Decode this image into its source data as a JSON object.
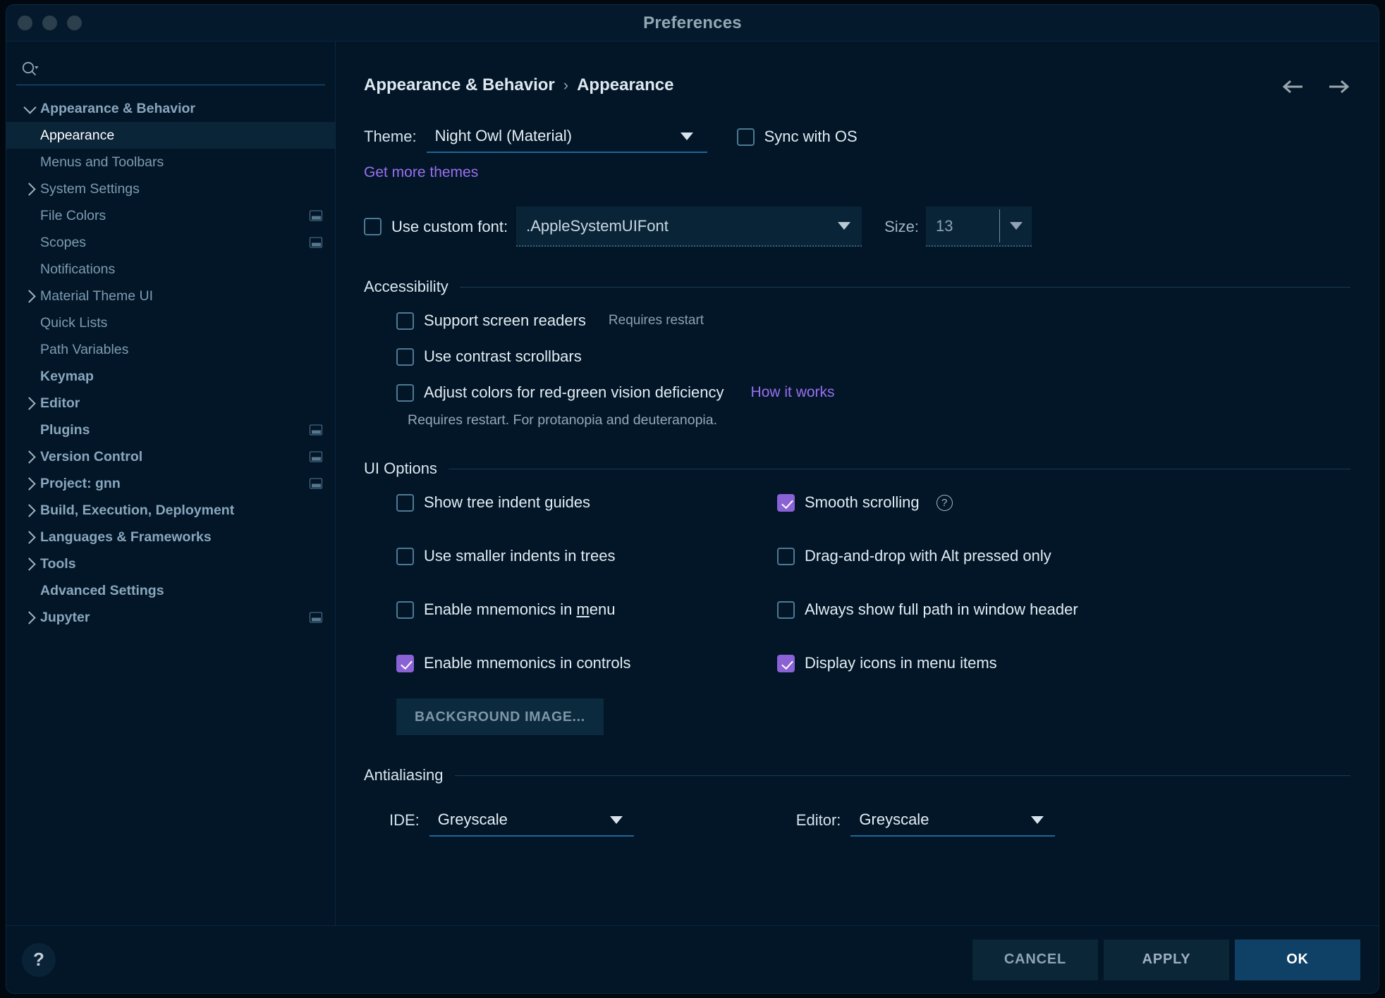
{
  "window": {
    "title": "Preferences"
  },
  "search": {
    "placeholder": "",
    "value": "",
    "icon": "search-icon"
  },
  "sidebar": {
    "items": [
      {
        "label": "Appearance & Behavior",
        "indent": 0,
        "arrow": "down",
        "bold": true,
        "selected": false,
        "badge": false
      },
      {
        "label": "Appearance",
        "indent": 1,
        "arrow": "none",
        "bold": false,
        "selected": true,
        "badge": false
      },
      {
        "label": "Menus and Toolbars",
        "indent": 1,
        "arrow": "none",
        "bold": false,
        "selected": false,
        "badge": false
      },
      {
        "label": "System Settings",
        "indent": 1,
        "arrow": "right",
        "bold": false,
        "selected": false,
        "badge": false
      },
      {
        "label": "File Colors",
        "indent": 1,
        "arrow": "none",
        "bold": false,
        "selected": false,
        "badge": true
      },
      {
        "label": "Scopes",
        "indent": 1,
        "arrow": "none",
        "bold": false,
        "selected": false,
        "badge": true
      },
      {
        "label": "Notifications",
        "indent": 1,
        "arrow": "none",
        "bold": false,
        "selected": false,
        "badge": false
      },
      {
        "label": "Material Theme UI",
        "indent": 1,
        "arrow": "right",
        "bold": false,
        "selected": false,
        "badge": false
      },
      {
        "label": "Quick Lists",
        "indent": 1,
        "arrow": "none",
        "bold": false,
        "selected": false,
        "badge": false
      },
      {
        "label": "Path Variables",
        "indent": 1,
        "arrow": "none",
        "bold": false,
        "selected": false,
        "badge": false
      },
      {
        "label": "Keymap",
        "indent": 0,
        "arrow": "none",
        "bold": true,
        "selected": false,
        "badge": false
      },
      {
        "label": "Editor",
        "indent": 0,
        "arrow": "right",
        "bold": true,
        "selected": false,
        "badge": false
      },
      {
        "label": "Plugins",
        "indent": 0,
        "arrow": "none",
        "bold": true,
        "selected": false,
        "badge": true
      },
      {
        "label": "Version Control",
        "indent": 0,
        "arrow": "right",
        "bold": true,
        "selected": false,
        "badge": true
      },
      {
        "label": "Project: gnn",
        "indent": 0,
        "arrow": "right",
        "bold": true,
        "selected": false,
        "badge": true
      },
      {
        "label": "Build, Execution, Deployment",
        "indent": 0,
        "arrow": "right",
        "bold": true,
        "selected": false,
        "badge": false
      },
      {
        "label": "Languages & Frameworks",
        "indent": 0,
        "arrow": "right",
        "bold": true,
        "selected": false,
        "badge": false
      },
      {
        "label": "Tools",
        "indent": 0,
        "arrow": "right",
        "bold": true,
        "selected": false,
        "badge": false
      },
      {
        "label": "Advanced Settings",
        "indent": 0,
        "arrow": "none",
        "bold": true,
        "selected": false,
        "badge": false
      },
      {
        "label": "Jupyter",
        "indent": 0,
        "arrow": "right",
        "bold": true,
        "selected": false,
        "badge": true
      }
    ]
  },
  "main": {
    "breadcrumb": {
      "parent": "Appearance & Behavior",
      "separator": "›",
      "current": "Appearance"
    },
    "nav": {
      "back_icon": "arrow-left-icon",
      "forward_icon": "arrow-right-icon"
    },
    "theme": {
      "label": "Theme:",
      "value": "Night Owl (Material)",
      "sync_label": "Sync with OS",
      "sync_checked": false,
      "get_more_themes": "Get more themes"
    },
    "custom_font": {
      "label": "Use custom font:",
      "checked": false,
      "value": ".AppleSystemUIFont",
      "size_label": "Size:",
      "size_value": "13"
    },
    "accessibility": {
      "title": "Accessibility",
      "items": [
        {
          "label": "Support screen readers",
          "checked": false,
          "hint": "Requires restart",
          "link": ""
        },
        {
          "label": "Use contrast scrollbars",
          "checked": false,
          "hint": "",
          "link": ""
        },
        {
          "label": "Adjust colors for red-green vision deficiency",
          "checked": false,
          "hint": "",
          "link": "How it works"
        }
      ],
      "note": "Requires restart. For protanopia and deuteranopia."
    },
    "ui_options": {
      "title": "UI Options",
      "left": [
        {
          "label": "Show tree indent guides",
          "checked": false,
          "help": false
        },
        {
          "label": "Use smaller indents in trees",
          "checked": false,
          "help": false
        },
        {
          "label": "Enable mnemonics in menu",
          "checked": false,
          "help": false,
          "mnemonic": "m"
        },
        {
          "label": "Enable mnemonics in controls",
          "checked": true,
          "help": false
        }
      ],
      "right": [
        {
          "label": "Smooth scrolling",
          "checked": true,
          "help": true
        },
        {
          "label": "Drag-and-drop with Alt pressed only",
          "checked": false,
          "help": false
        },
        {
          "label": "Always show full path in window header",
          "checked": false,
          "help": false
        },
        {
          "label": "Display icons in menu items",
          "checked": true,
          "help": false
        }
      ],
      "background_image_button": "BACKGROUND IMAGE..."
    },
    "antialiasing": {
      "title": "Antialiasing",
      "ide_label": "IDE:",
      "ide_value": "Greyscale",
      "editor_label": "Editor:",
      "editor_value": "Greyscale"
    }
  },
  "footer": {
    "help_icon": "question-mark-icon",
    "cancel": "CANCEL",
    "apply": "APPLY",
    "ok": "OK"
  },
  "colors": {
    "window_bg": "#021627",
    "titlebar_bg": "#04192b",
    "selection_bg": "#0a2438",
    "accent_purple": "#8a62d6",
    "link_purple": "#9a6ff0",
    "underline_blue": "#1f6696",
    "ok_button_bg": "#0f4066"
  }
}
